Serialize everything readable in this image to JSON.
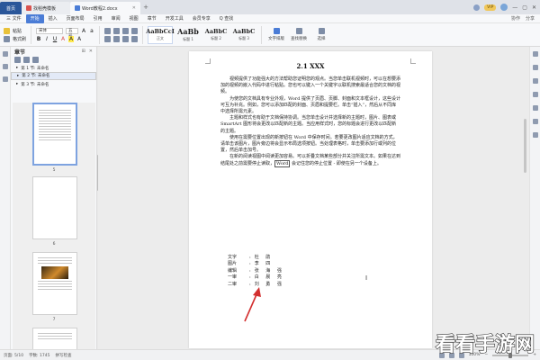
{
  "titlebar": {
    "home_tab": "首页",
    "tabs": [
      {
        "label": "找稻壳模板",
        "active": false
      },
      {
        "label": "Word教程2.docx",
        "active": true
      }
    ],
    "vip_label": "VIP"
  },
  "menubar": {
    "items": [
      "三 文件",
      "开始",
      "插入",
      "页面布局",
      "引用",
      "审阅",
      "视图",
      "章节",
      "开发工具",
      "会员专享"
    ],
    "active_index": 1,
    "search": "Q 查找",
    "right": [
      "协作",
      "分享"
    ]
  },
  "ribbon": {
    "clipboard": [
      "粘贴",
      "格式刷"
    ],
    "font_name": "宋体",
    "font_size": "五号",
    "styles": [
      {
        "sample": "AaBbCcI",
        "name": "正文"
      },
      {
        "sample": "AaBb",
        "name": "标题 1"
      },
      {
        "sample": "AaBbC",
        "name": "标题 2"
      },
      {
        "sample": "AaBbC",
        "name": "标题 3"
      }
    ],
    "tools": [
      "文字排版",
      "查找替换",
      "选择"
    ]
  },
  "nav": {
    "title": "章节",
    "items": [
      {
        "label": "第 1 节: 未命名",
        "selected": false
      },
      {
        "label": "第 2 节: 未命名",
        "selected": true
      },
      {
        "label": "第 3 节: 未命名",
        "selected": false
      }
    ],
    "pages": [
      "5",
      "6",
      "7"
    ]
  },
  "document": {
    "title": "2.1 XXX",
    "paragraphs": [
      "视频提供了功能强大的方法帮助您证明您的观点。当您单击联机视频时，可以在想要添加的视频的嵌入代码中进行粘贴。您也可以键入一个关键字以联机搜索最适合您的文档的视频。",
      "为使您的文档具有专业外观，Word 提供了页眉、页脚、封面和文本框设计，这些设计可互为补充。例如，您可以添加匹配的封面、页眉和提要栏。单击“插入”，然后从不同库中选择所需元素。",
      "主题和样式也有助于文档保持协调。当您单击设计并选择新的主题时，图片、图表或 SmartArt 图形将会更改以匹配新的主题。当应用样式时，您的标题会进行更改以匹配新的主题。",
      "使用在需要位置出现的新按钮在 Word 中保存时间。若要更改图片适应文档的方式，请单击该图片，图片旁边将会显示布局选项按钮。当处理表格时，单击要添加行或列的位置，然后单击加号。",
      "在新的阅读视图中阅读更加容易。可以折叠文档某些部分并关注所需文本。如果在达到结尾处之前需要停止读取，Word 会记住您的停止位置 - 即使在另一个设备上。"
    ],
    "boxed_word": "Word",
    "names": [
      {
        "role": "文字",
        "name": "杜 鹃"
      },
      {
        "role": "图片",
        "name": "李 四"
      },
      {
        "role": "编辑",
        "name": "张 海 强"
      },
      {
        "role": "一审",
        "name": "白 晨 亮"
      },
      {
        "role": "二审",
        "name": "刘 勇 强"
      }
    ]
  },
  "statusbar": {
    "page": "页面: 5/10",
    "words": "字数: 1745",
    "spell": "拼写检查",
    "zoom": "100%"
  },
  "watermark": {
    "text": "看看手游网"
  },
  "colors": {
    "accent": "#4a7cd6",
    "home_tab": "#2b579a",
    "arrow": "#d32f2f"
  }
}
